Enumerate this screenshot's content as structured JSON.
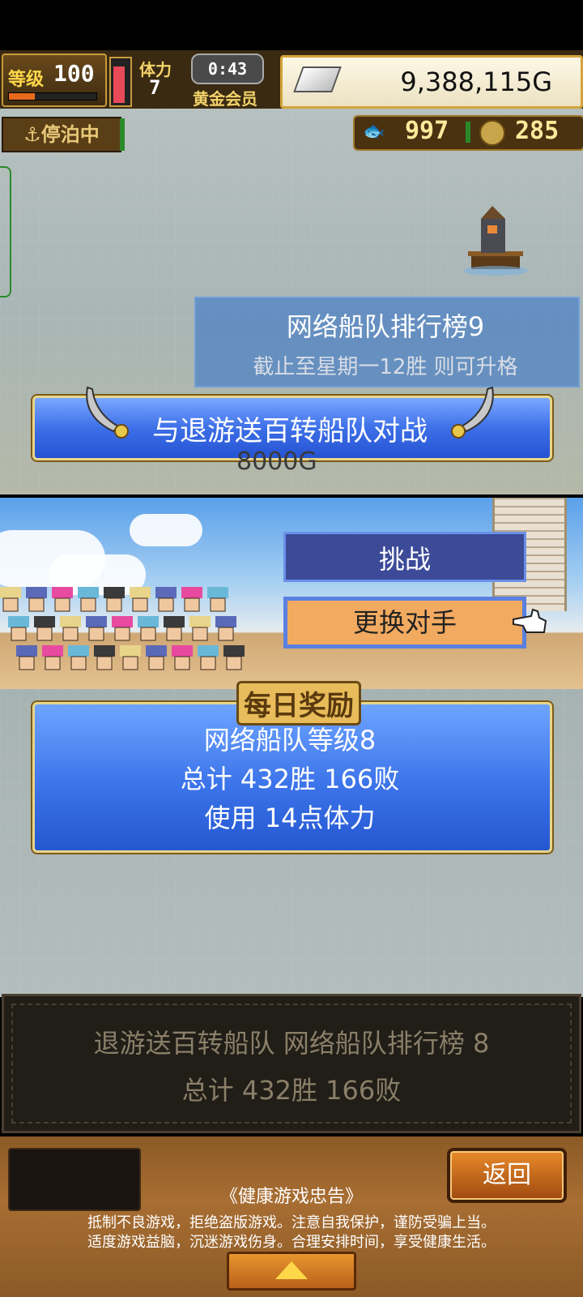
{
  "hud": {
    "level_label": "等级",
    "level_value": "100",
    "level_progress": 0.3,
    "stamina_label": "体力",
    "stamina_value": "7",
    "stamina_level": 0.9,
    "timer": "0:43",
    "member_label": "黄金会员",
    "gold": "9,388,115G",
    "dock_status": "停泊中",
    "resource1_value": "997",
    "resource2_value": "285"
  },
  "ranking": {
    "title": "网络船队排行榜9",
    "subtitle": "截止至星期一12胜 则可升格"
  },
  "battle": {
    "label": "与退游送百转船队对战",
    "prize": "8000G"
  },
  "actions": {
    "challenge_label": "挑战",
    "change_opponent_label": "更换对手"
  },
  "reward": {
    "title": "每日奖励",
    "line1": "网络船队等级8",
    "line2": "总计 432胜 166败",
    "line3": "使用 14点体力"
  },
  "info": {
    "line1": "退游送百转船队  网络船队排行榜  8",
    "line2": "总计 432胜 166败"
  },
  "footer": {
    "back_label": "返回",
    "notice_title": "《健康游戏忠告》",
    "notice_line1": "抵制不良游戏，拒绝盗版游戏。注意自我保护，谨防受骗上当。",
    "notice_line2": "适度游戏益脑，沉迷游戏伤身。合理安排时间，享受健康生活。"
  },
  "icons": {
    "dock": "anchor-icon",
    "gold": "silver-bar-icon",
    "resource1": "fish-icon",
    "resource2": "coin-icon",
    "pointer": "pointing-hand-icon",
    "expand": "up-arrow-icon"
  },
  "colors": {
    "banner_blue": "#3d6fe8",
    "gold_trim": "#e8d58a",
    "challenge_bg": "#3c4a98",
    "change_bg": "#f2aa60"
  }
}
